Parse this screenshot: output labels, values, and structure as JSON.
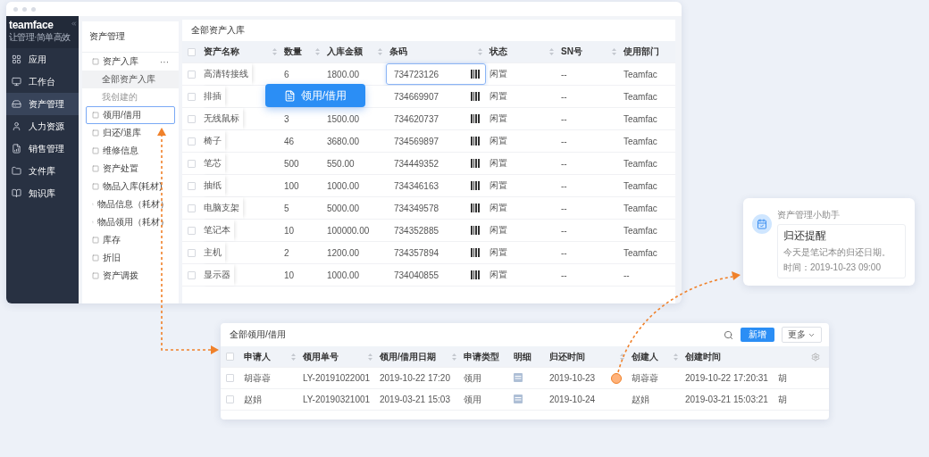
{
  "main_window": {
    "sidebar": {
      "logo": "teamface",
      "tagline": "让管理·简单高效",
      "items": [
        {
          "label": "应用",
          "selected": false
        },
        {
          "label": "工作台",
          "selected": false
        },
        {
          "label": "资产管理",
          "selected": true
        },
        {
          "label": "人力资源",
          "selected": false
        },
        {
          "label": "销售管理",
          "selected": false
        },
        {
          "label": "文件库",
          "selected": false
        },
        {
          "label": "知识库",
          "selected": false
        }
      ]
    },
    "subnav": {
      "title": "资产管理",
      "items": [
        {
          "label": "资产入库",
          "selected": false,
          "focused": false,
          "more": "···",
          "children": [
            {
              "label": "全部资产入库",
              "selected": true
            },
            {
              "label": "我创建的",
              "selected": false
            }
          ]
        },
        {
          "label": "领用/借用",
          "selected": false,
          "focused": true
        },
        {
          "label": "归还/退库",
          "selected": false,
          "focused": false
        },
        {
          "label": "维修信息",
          "selected": false,
          "focused": false
        },
        {
          "label": "资产处置",
          "selected": false,
          "focused": false
        },
        {
          "label": "物品入库(耗材)",
          "selected": false,
          "focused": false
        },
        {
          "label": "物品信息（耗材）",
          "selected": false,
          "focused": false
        },
        {
          "label": "物品领用（耗材）",
          "selected": false,
          "focused": false
        },
        {
          "label": "库存",
          "selected": false,
          "focused": false
        },
        {
          "label": "折旧",
          "selected": false,
          "focused": false
        },
        {
          "label": "资产调拨",
          "selected": false,
          "focused": false
        }
      ]
    },
    "table": {
      "title": "全部资产入库",
      "all_checked": false,
      "columns": [
        "资产名称",
        "数量",
        "入库金额",
        "条码",
        "状态",
        "SN号",
        "使用部门"
      ],
      "rows": [
        {
          "checked": false,
          "name": "高清转接线",
          "qty": "6",
          "amount": "1800.00",
          "barcode": "734723126",
          "barcode_focused": true,
          "status": "闲置",
          "sn": "--",
          "dept": "Teamfac"
        },
        {
          "checked": false,
          "name": "排插",
          "barcode": "734669907",
          "barcode_focused": false,
          "status": "闲置",
          "sn": "--",
          "dept": "Teamfac"
        },
        {
          "checked": false,
          "name": "无线鼠标",
          "qty": "3",
          "amount": "1500.00",
          "barcode": "734620737",
          "barcode_focused": false,
          "status": "闲置",
          "sn": "--",
          "dept": "Teamfac"
        },
        {
          "checked": false,
          "name": "椅子",
          "qty": "46",
          "amount": "3680.00",
          "barcode": "734569897",
          "barcode_focused": false,
          "status": "闲置",
          "sn": "--",
          "dept": "Teamfac"
        },
        {
          "checked": false,
          "name": "笔芯",
          "qty": "500",
          "amount": "550.00",
          "barcode": "734449352",
          "barcode_focused": false,
          "status": "闲置",
          "sn": "--",
          "dept": "Teamfac"
        },
        {
          "checked": false,
          "name": "抽纸",
          "qty": "100",
          "amount": "1000.00",
          "barcode": "734346163",
          "barcode_focused": false,
          "status": "闲置",
          "sn": "--",
          "dept": "Teamfac"
        },
        {
          "checked": false,
          "name": "电脑支架",
          "qty": "5",
          "amount": "5000.00",
          "barcode": "734349578",
          "barcode_focused": false,
          "status": "闲置",
          "sn": "--",
          "dept": "Teamfac"
        },
        {
          "checked": false,
          "name": "笔记本",
          "qty": "10",
          "amount": "100000.00",
          "barcode": "734352885",
          "barcode_focused": false,
          "status": "闲置",
          "sn": "--",
          "dept": "Teamfac"
        },
        {
          "checked": false,
          "name": "主机",
          "qty": "2",
          "amount": "1200.00",
          "barcode": "734357894",
          "barcode_focused": false,
          "status": "闲置",
          "sn": "--",
          "dept": "Teamfac"
        },
        {
          "checked": false,
          "name": "显示器",
          "qty": "10",
          "amount": "1000.00",
          "barcode": "734040855",
          "barcode_focused": false,
          "status": "闲置",
          "sn": "--",
          "dept": "--"
        }
      ]
    }
  },
  "floating_button": {
    "label": "领用/借用"
  },
  "borrow_panel": {
    "title": "全部领用/借用",
    "new_button": "新增",
    "more_button": "更多",
    "all_checked": false,
    "columns": [
      "申请人",
      "领用单号",
      "领用/借用日期",
      "申请类型",
      "明细",
      "归还时间",
      "创建人",
      "创建时间"
    ],
    "rows": [
      {
        "checked": false,
        "applicant": "胡蓉蓉",
        "number": "LY-20191022001",
        "date": "2019-10-22 17:20",
        "type": "领用",
        "return_date": "2019-10-23",
        "creator": "胡蓉蓉",
        "created": "2019-10-22 17:20:31",
        "column_9": "胡"
      },
      {
        "checked": false,
        "applicant": "赵娟",
        "number": "LY-20190321001",
        "date": "2019-03-21 15:03",
        "type": "领用",
        "return_date": "2019-10-24",
        "creator": "赵娟",
        "created": "2019-03-21 15:03:21",
        "column_9": "胡"
      }
    ]
  },
  "notification": {
    "sender": "资产管理小助手",
    "title": "归还提醒",
    "message": "今天是笔记本的归还日期。",
    "time": "时间：2019-10-23 09:00"
  }
}
